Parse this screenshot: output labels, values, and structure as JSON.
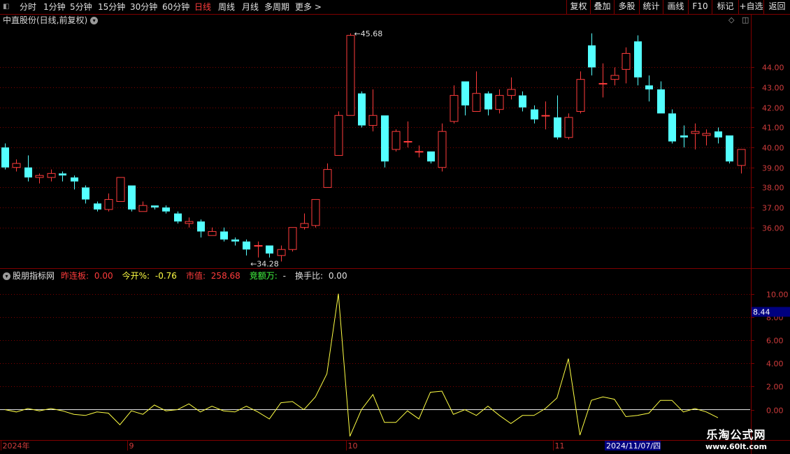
{
  "toolbar": {
    "periods": [
      {
        "label": "分时",
        "active": false
      },
      {
        "label": "1分钟",
        "active": false
      },
      {
        "label": "5分钟",
        "active": false
      },
      {
        "label": "15分钟",
        "active": false
      },
      {
        "label": "30分钟",
        "active": false
      },
      {
        "label": "60分钟",
        "active": false
      },
      {
        "label": "日线",
        "active": true
      },
      {
        "label": "周线",
        "active": false
      },
      {
        "label": "月线",
        "active": false
      },
      {
        "label": "多周期",
        "active": false
      },
      {
        "label": "更多 >",
        "active": false
      }
    ],
    "buttons": [
      "复权",
      "叠加",
      "多股",
      "统计",
      "画线",
      "F10",
      "标记",
      "+自选",
      "返回"
    ]
  },
  "header": {
    "stock_title": "中直股份(日线,前复权)"
  },
  "indicator_header": {
    "name": "股朋指标网",
    "items": [
      {
        "label": "昨连板:",
        "value": "0.00",
        "color": "#ff3c3c"
      },
      {
        "label": "今开%:",
        "value": "-0.76",
        "color": "#ffff44"
      },
      {
        "label": "市值:",
        "value": "258.68",
        "color": "#ff3c3c"
      },
      {
        "label": "竞额万:",
        "value": "-",
        "color": "#44ff44"
      },
      {
        "label": "换手比:",
        "value": "0.00",
        "color": "#e0e0e0"
      }
    ]
  },
  "colors": {
    "up": "#ff3c3c",
    "down": "#54ffff",
    "line": "#ffff44",
    "grid": "#800000",
    "axis_text": "#d03c3c"
  },
  "chart_data": [
    {
      "type": "candlestick",
      "title": "中直股份(日线,前复权)",
      "ylim": [
        34.0,
        46.6
      ],
      "y_ticks": [
        "36.00",
        "37.00",
        "38.00",
        "39.00",
        "40.00",
        "41.00",
        "42.00",
        "43.00",
        "44.00"
      ],
      "annotations": [
        {
          "text": "45.68",
          "type": "high"
        },
        {
          "text": "34.28",
          "type": "low"
        }
      ],
      "candles": [
        [
          40.0,
          39.0,
          40.2,
          38.9
        ],
        [
          39.0,
          39.2,
          39.4,
          38.8
        ],
        [
          39.0,
          38.5,
          39.6,
          38.3
        ],
        [
          38.5,
          38.6,
          38.7,
          38.2
        ],
        [
          38.5,
          38.7,
          38.9,
          38.3
        ],
        [
          38.7,
          38.6,
          38.8,
          38.3
        ],
        [
          38.5,
          38.3,
          38.6,
          37.9
        ],
        [
          38.0,
          37.4,
          38.1,
          37.2
        ],
        [
          37.2,
          36.9,
          37.3,
          36.8
        ],
        [
          36.9,
          37.4,
          37.7,
          36.8
        ],
        [
          37.3,
          38.5,
          38.5,
          37.3
        ],
        [
          38.1,
          36.9,
          38.1,
          36.8
        ],
        [
          36.8,
          37.1,
          37.3,
          36.8
        ],
        [
          37.1,
          37.0,
          37.1,
          36.9
        ],
        [
          37.0,
          36.8,
          37.1,
          36.7
        ],
        [
          36.7,
          36.3,
          36.8,
          36.2
        ],
        [
          36.2,
          36.3,
          36.5,
          36.0
        ],
        [
          36.3,
          35.8,
          36.4,
          35.5
        ],
        [
          35.6,
          35.8,
          36.0,
          35.6
        ],
        [
          35.8,
          35.4,
          36.0,
          35.3
        ],
        [
          35.4,
          35.3,
          35.5,
          35.1
        ],
        [
          35.3,
          34.9,
          35.4,
          34.6
        ],
        [
          35.1,
          35.1,
          35.3,
          34.5
        ],
        [
          35.1,
          34.7,
          35.1,
          34.5
        ],
        [
          34.6,
          34.9,
          35.1,
          34.3
        ],
        [
          34.9,
          36.0,
          36.0,
          34.8
        ],
        [
          36.0,
          36.2,
          36.7,
          35.9
        ],
        [
          36.1,
          37.4,
          37.4,
          36.0
        ],
        [
          38.0,
          38.9,
          39.2,
          38.0
        ],
        [
          39.6,
          41.6,
          41.8,
          39.6
        ],
        [
          41.6,
          45.6,
          45.7,
          41.8
        ],
        [
          42.7,
          41.1,
          42.8,
          41.0
        ],
        [
          41.1,
          41.6,
          42.9,
          40.8
        ],
        [
          41.6,
          39.3,
          41.6,
          39.0
        ],
        [
          39.9,
          40.8,
          40.9,
          39.8
        ],
        [
          40.3,
          40.3,
          41.3,
          40.0
        ],
        [
          39.8,
          39.8,
          40.1,
          39.5
        ],
        [
          39.8,
          39.3,
          39.8,
          39.2
        ],
        [
          39.0,
          40.8,
          41.2,
          38.8
        ],
        [
          41.3,
          42.6,
          43.1,
          41.2
        ],
        [
          43.3,
          42.1,
          43.3,
          41.6
        ],
        [
          41.8,
          42.7,
          43.8,
          41.8
        ],
        [
          42.7,
          41.9,
          42.8,
          41.6
        ],
        [
          41.9,
          42.6,
          42.9,
          41.7
        ],
        [
          42.6,
          42.9,
          43.5,
          42.4
        ],
        [
          42.6,
          42.0,
          42.8,
          41.8
        ],
        [
          41.9,
          41.4,
          42.1,
          41.2
        ],
        [
          41.6,
          41.6,
          42.3,
          40.9
        ],
        [
          41.5,
          40.5,
          42.6,
          40.4
        ],
        [
          40.5,
          41.5,
          41.7,
          40.4
        ],
        [
          41.8,
          43.4,
          43.8,
          41.7
        ],
        [
          45.1,
          44.0,
          45.7,
          43.6
        ],
        [
          43.2,
          43.2,
          44.2,
          42.5
        ],
        [
          43.4,
          43.6,
          44.0,
          43.1
        ],
        [
          43.9,
          44.7,
          45.0,
          43.2
        ],
        [
          45.3,
          43.5,
          45.6,
          43.1
        ],
        [
          43.1,
          42.9,
          43.6,
          42.3
        ],
        [
          42.9,
          41.7,
          43.3,
          41.7
        ],
        [
          41.7,
          40.3,
          41.9,
          40.2
        ],
        [
          40.6,
          40.5,
          41.1,
          40.0
        ],
        [
          40.7,
          40.8,
          41.2,
          39.9
        ],
        [
          40.6,
          40.7,
          40.9,
          40.1
        ],
        [
          40.8,
          40.5,
          41.0,
          40.2
        ],
        [
          40.6,
          39.3,
          40.6,
          39.2
        ],
        [
          39.1,
          39.9,
          39.9,
          38.7
        ]
      ]
    },
    {
      "type": "line",
      "title": "股朋指标网",
      "ylim": [
        -2.5,
        11.0
      ],
      "y_ticks": [
        "0.00",
        "2.00",
        "4.00",
        "6.00",
        "8.00",
        "10.00"
      ],
      "last_value_label": "8.44",
      "series": [
        {
          "values": [
            0.0,
            -0.2,
            0.1,
            -0.1,
            0.1,
            -0.1,
            -0.4,
            -0.5,
            -0.2,
            -0.3,
            -1.3,
            -0.1,
            -0.4,
            0.4,
            -0.1,
            0.0,
            0.5,
            -0.2,
            0.3,
            -0.1,
            -0.2,
            0.3,
            -0.2,
            -0.8,
            0.6,
            0.7,
            0.0,
            1.1,
            3.1,
            10.0,
            -2.3,
            0.0,
            1.3,
            -1.1,
            -1.1,
            -0.1,
            -0.8,
            1.5,
            1.6,
            -0.4,
            0.0,
            -0.5,
            0.3,
            -0.5,
            -1.2,
            -0.5,
            -0.5,
            0.1,
            1.0,
            4.4,
            -2.2,
            0.8,
            1.1,
            0.9,
            -0.6,
            -0.5,
            -0.3,
            0.8,
            0.8,
            -0.2,
            0.1,
            -0.2,
            -0.7
          ]
        }
      ]
    }
  ],
  "date_axis": {
    "labels": [
      {
        "text": "2024年",
        "bar": 0
      },
      {
        "text": "9",
        "bar": 11
      },
      {
        "text": "10",
        "bar": 30
      },
      {
        "text": "11",
        "bar": 48
      }
    ],
    "cursor_date": "2024/11/07/四"
  },
  "watermark": {
    "line1": "乐淘公式网",
    "line2": "www.60lt.com"
  }
}
